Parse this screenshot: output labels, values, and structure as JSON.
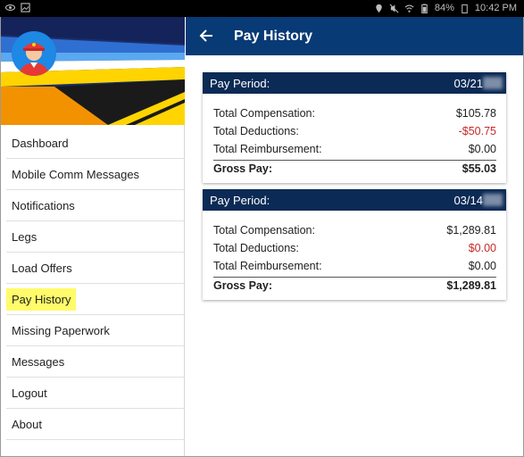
{
  "status_bar": {
    "battery": "84%",
    "time": "10:42 PM"
  },
  "sidebar": {
    "items": [
      {
        "label": "Dashboard"
      },
      {
        "label": "Mobile Comm Messages"
      },
      {
        "label": "Notifications"
      },
      {
        "label": "Legs"
      },
      {
        "label": "Load Offers"
      },
      {
        "label": "Pay History"
      },
      {
        "label": "Missing Paperwork"
      },
      {
        "label": "Messages"
      },
      {
        "label": "Logout"
      },
      {
        "label": "About"
      }
    ],
    "active": "Pay History"
  },
  "appbar": {
    "title": "Pay History"
  },
  "cards": [
    {
      "period_label": "Pay Period:",
      "period_date": "03/21",
      "rows": [
        {
          "label": "Total Compensation:",
          "value": "$105.78"
        },
        {
          "label": "Total Deductions:",
          "value": "-$50.75"
        },
        {
          "label": "Total Reimbursement:",
          "value": "$0.00"
        }
      ],
      "total": {
        "label": "Gross Pay:",
        "value": "$55.03"
      }
    },
    {
      "period_label": "Pay Period:",
      "period_date": "03/14",
      "rows": [
        {
          "label": "Total Compensation:",
          "value": "$1,289.81"
        },
        {
          "label": "Total Deductions:",
          "value": "$0.00"
        },
        {
          "label": "Total Reimbursement:",
          "value": "$0.00"
        }
      ],
      "total": {
        "label": "Gross Pay:",
        "value": "$1,289.81"
      }
    }
  ],
  "colors": {
    "appbar": "#083a75",
    "card_header": "#0b2a55",
    "negative": "#c62828",
    "highlight": "#fffb6a"
  }
}
